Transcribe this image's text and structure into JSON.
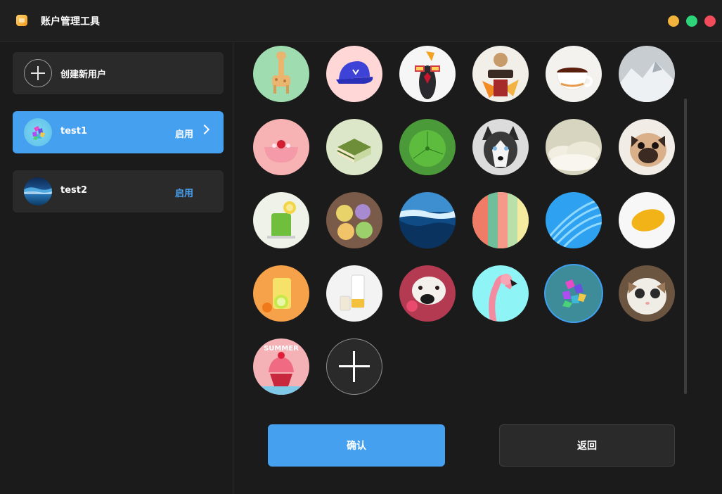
{
  "window": {
    "title": "账户管理工具",
    "app_icon": "folder-app-icon",
    "controls": [
      "minimize-button",
      "maximize-button",
      "close-button"
    ],
    "colors": {
      "minimize": "#f2b33d",
      "maximize": "#2ed47a",
      "close": "#f24b5c"
    }
  },
  "sidebar": {
    "create_label": "创建新用户",
    "users": [
      {
        "name": "test1",
        "status": "启用",
        "selected": true,
        "avatar": "colorful-cubes-avatar"
      },
      {
        "name": "test2",
        "status": "启用",
        "selected": false,
        "avatar": "ocean-wave-avatar"
      }
    ],
    "accent": "#45a0f0"
  },
  "avatars": [
    {
      "id": "giraffe-toy"
    },
    {
      "id": "blue-cap"
    },
    {
      "id": "penguin-character"
    },
    {
      "id": "collage-figure"
    },
    {
      "id": "coffee-cup"
    },
    {
      "id": "snowy-mountains"
    },
    {
      "id": "strawberry-bowl"
    },
    {
      "id": "matcha-cake"
    },
    {
      "id": "green-leaf"
    },
    {
      "id": "husky-dog"
    },
    {
      "id": "clouds"
    },
    {
      "id": "pug-dog"
    },
    {
      "id": "green-juice"
    },
    {
      "id": "drinks-top-view"
    },
    {
      "id": "ocean-wave"
    },
    {
      "id": "color-stripes"
    },
    {
      "id": "blue-waves"
    },
    {
      "id": "mango"
    },
    {
      "id": "lemon-drink"
    },
    {
      "id": "milk-glass"
    },
    {
      "id": "dog-with-flower"
    },
    {
      "id": "flamingo"
    },
    {
      "id": "colorful-cubes",
      "selected": true
    },
    {
      "id": "cat-face"
    },
    {
      "id": "summer-cupcake"
    }
  ],
  "add_avatar": "add-avatar-button",
  "buttons": {
    "confirm": "确认",
    "back": "返回"
  }
}
